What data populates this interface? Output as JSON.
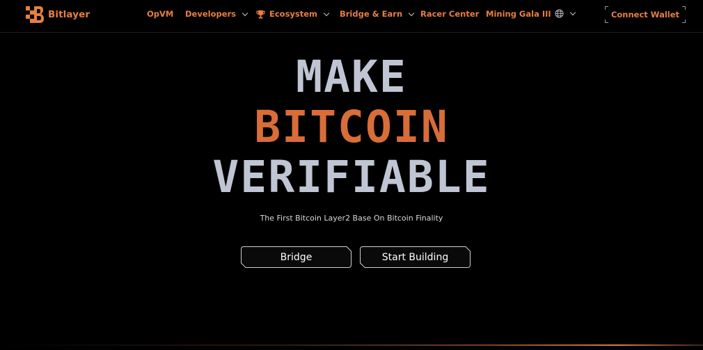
{
  "brand": {
    "name": "Bitlayer",
    "accent": "#e77e43",
    "logo_icon": "bitlayer-logo-icon"
  },
  "nav": {
    "items": [
      {
        "label": "OpVM",
        "has_dropdown": false
      },
      {
        "label": "Developers",
        "has_dropdown": true
      },
      {
        "label": "Ecosystem",
        "has_dropdown": true,
        "icon": "trophy-icon"
      },
      {
        "label": "Bridge & Earn",
        "has_dropdown": true
      },
      {
        "label": "Racer Center",
        "has_dropdown": false
      },
      {
        "label": "Mining Gala III",
        "has_dropdown": false
      }
    ],
    "language_icon": "globe-icon",
    "connect_wallet": "Connect Wallet"
  },
  "hero": {
    "line1": "MAKE",
    "line2": "BITCOIN",
    "line3": "VERIFIABLE",
    "subtitle": "The First Bitcoin Layer2 Base On Bitcoin Finality",
    "colors": {
      "primary": "#c0c5d3",
      "accent": "#d86d38"
    }
  },
  "actions": {
    "bridge": "Bridge",
    "start_building": "Start Building"
  }
}
